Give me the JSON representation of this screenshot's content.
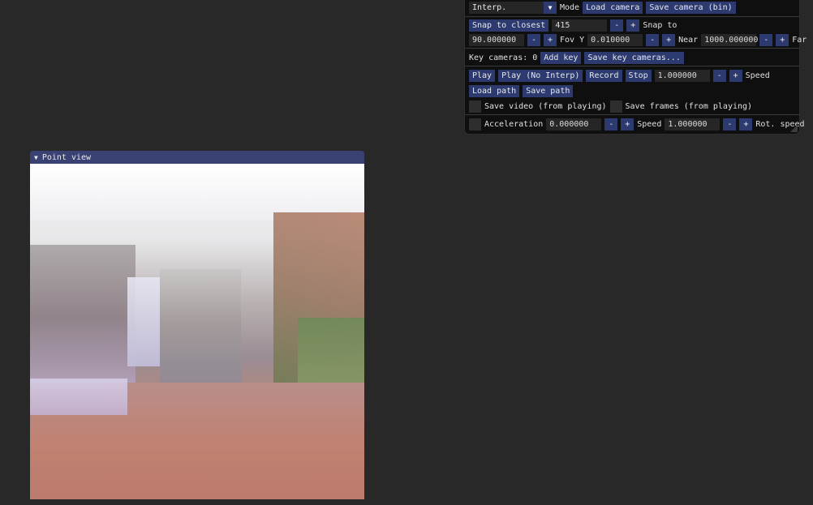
{
  "camera_panel": {
    "mode_combo": {
      "value": "Interp.",
      "label": "Mode"
    },
    "load_camera": "Load camera",
    "save_camera_bin": "Save camera (bin)",
    "snap_to_closest": "Snap to closest",
    "snap_value": "415",
    "snap_label": "Snap to",
    "fov_value": "90.000000",
    "fov_label": "Fov Y",
    "near_value": "0.010000",
    "near_label": "Near",
    "far_value": "1000.000000",
    "far_label": "Far",
    "key_cameras_label": "Key cameras: 0",
    "add_key": "Add key",
    "save_key_cameras": "Save key cameras...",
    "play": "Play",
    "play_no_interp": "Play (No Interp)",
    "record": "Record",
    "stop": "Stop",
    "play_speed_value": "1.000000",
    "play_speed_label": "Speed",
    "load_path": "Load path",
    "save_path": "Save path",
    "save_video": "Save video (from playing)",
    "save_frames": "Save frames (from playing)",
    "acceleration_value": "0.000000",
    "acceleration_label": "Acceleration",
    "speed_value": "1.000000",
    "speed_label": "Speed",
    "rot_speed_label": "Rot. speed",
    "minus": "-",
    "plus": "+"
  },
  "point_view": {
    "title": "Point view"
  },
  "colors": {
    "background": "#282828",
    "panel": "#0f0f0f",
    "button": "#2c3a70",
    "title_bar": "#3a4173"
  }
}
